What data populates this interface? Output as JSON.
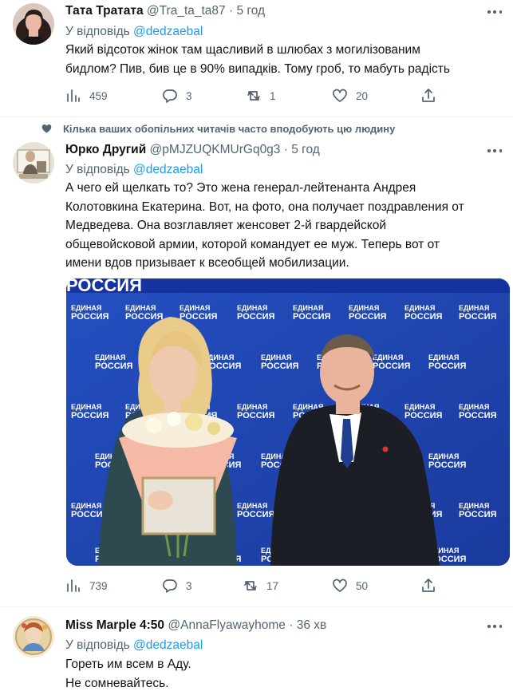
{
  "tweet1": {
    "name": "Тата Тратата",
    "handle": "@Tra_ta_ta87",
    "dot": "·",
    "time": "5 год",
    "reply_prefix": "У відповідь",
    "reply_to": "@dedzaebal",
    "text_lines": [
      "Який відсоток жінок там щасливий в шлюбах з могилізованим",
      "бидлом? Пив, бив це в 90% випадків. Тому гроб, то мабуть радість"
    ],
    "stats": {
      "views": "459",
      "replies": "3",
      "retweets": "1",
      "likes": "20"
    }
  },
  "social_context": "Кілька ваших обопільних читачів часто вподобують цю людину",
  "tweet2": {
    "name": "Юрко Другий",
    "handle": "@pMJZUQKMUrGq0g3",
    "dot": "·",
    "time": "5 год",
    "reply_prefix": "У відповідь",
    "reply_to": "@dedzaebal",
    "text_lines": [
      "А чего ей щелкать то? Это жена генерал-лейтенанта Андрея",
      "Колотовкина Екатерина. Вот, на фото, она получает поздравления от",
      "Медведева. Она возглавляет женсовет 2-й гвардейской",
      "общевойсковой армии, которой командует ее муж. Теперь вот от",
      "имени вдов призывает к всеобщей мобилизации."
    ],
    "photo": {
      "banner_text": "РОССИЯ",
      "logo_line1": "ЕДИНАЯ",
      "logo_line2": "РОССИЯ"
    },
    "stats": {
      "views": "739",
      "replies": "3",
      "retweets": "17",
      "likes": "50"
    }
  },
  "tweet3": {
    "name": "Miss Marple 4:50",
    "handle": "@AnnaFlyawayhome",
    "dot": "·",
    "time": "36 хв",
    "reply_prefix": "У відповідь",
    "reply_to": "@dedzaebal",
    "text_lines": [
      "Гореть им всем в Аду.",
      "Не сомневайтесь."
    ]
  },
  "colors": {
    "text": "#0f1419",
    "secondary": "#536471",
    "accent": "#1d9bf0",
    "divider": "#eff3f4",
    "photo_backdrop": "#1e3ea0"
  },
  "icons": [
    "views-icon",
    "reply-icon",
    "retweet-icon",
    "like-icon",
    "share-icon",
    "more-icon",
    "heart-filled-icon"
  ]
}
